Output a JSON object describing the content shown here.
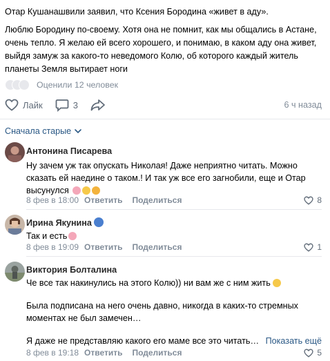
{
  "post": {
    "paragraph1": "Отар Кушанашвили заявил, что Ксения Бородина «живет в аду».",
    "paragraph2": "Люблю Бородину по-своему. Хотя она не помнит, как мы общались в Астане, очень тепло. Я желаю ей всего хорошего, и понимаю, в каком аду она живет, выйдя замуж за какого-то неведомого Колю, об которого каждый житель планеты Земля вытирает ноги",
    "liked_text": "Оценили 12 человек",
    "like_label": "Лайк",
    "comments_count": "3",
    "time_ago": "6 ч назад"
  },
  "sort_label": "Сначала старые",
  "comments": [
    {
      "name": "Антонина Писарева",
      "text": "Ну зачем уж так опускать Николая! Даже неприятно читать. Можно сказать ей наедине о таком.! И так уж все его загнобили, еще и Отар высунулся",
      "date": "8 фев в 18:00",
      "reply": "Ответить",
      "share": "Поделиться",
      "likes": "8"
    },
    {
      "name": "Ирина Якунина",
      "text": "Так и есть",
      "date": "8 фев в 19:09",
      "reply": "Ответить",
      "share": "Поделиться",
      "likes": "1"
    },
    {
      "name": "Виктория Болталина",
      "text1": "Че все так накинулись на этого Колю)) ни вам же с ним жить",
      "text2": "Была подписана на него очень давно, никогда в каких-то стремных моментах не был замечен…",
      "text3": "Я даже не представляю какого его маме все это читать…",
      "show_more": "Показать ещё",
      "date": "8 фев в 19:18",
      "reply": "Ответить",
      "share": "Поделиться",
      "likes": "5"
    }
  ],
  "colors": {
    "link": "#2a5885",
    "muted": "#818c99",
    "icon": "#626d7a"
  }
}
